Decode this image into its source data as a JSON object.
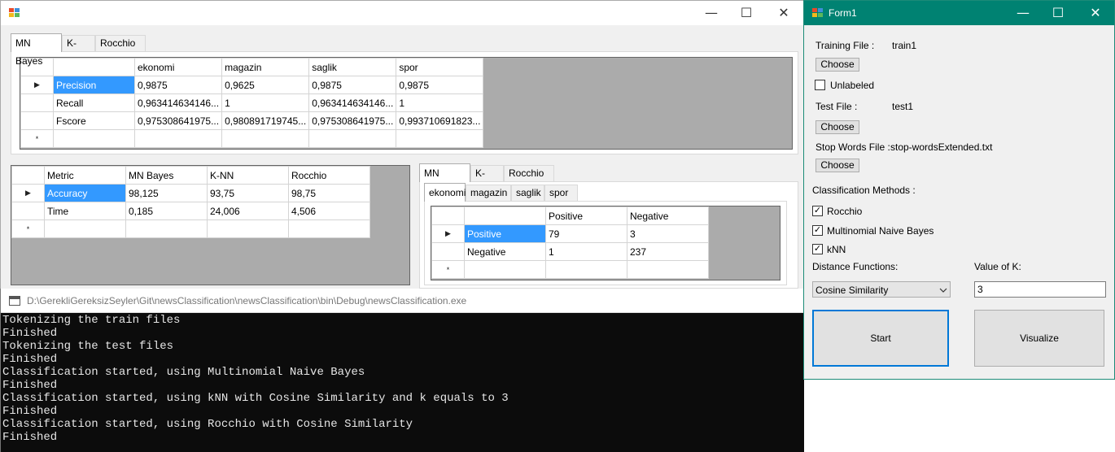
{
  "main_window": {
    "caption_buttons": {
      "minimize": "—",
      "maximize": "☐",
      "close": "✕"
    },
    "top_tabs": [
      "MN Bayes",
      "K-NN",
      "Rocchio"
    ],
    "metrics_grid": {
      "columns": [
        "",
        "ekonomi",
        "magazin",
        "saglik",
        "spor"
      ],
      "rows": [
        [
          "Precision",
          "0,9875",
          "0,9625",
          "0,9875",
          "0,9875"
        ],
        [
          "Recall",
          "0,963414634146...",
          "1",
          "0,963414634146...",
          "1"
        ],
        [
          "Fscore",
          "0,975308641975...",
          "0,980891719745...",
          "0,975308641975...",
          "0,993710691823..."
        ]
      ]
    },
    "accuracy_grid": {
      "columns": [
        "Metric",
        "MN Bayes",
        "K-NN",
        "Rocchio"
      ],
      "rows": [
        [
          "Accuracy",
          "98,125",
          "93,75",
          "98,75"
        ],
        [
          "Time",
          "0,185",
          "24,006",
          "4,506"
        ]
      ]
    },
    "method_tabs": [
      "MN Bayes",
      "K-NN",
      "Rocchio"
    ],
    "category_tabs": [
      "ekonomi",
      "magazin",
      "saglik",
      "spor"
    ],
    "confusion_grid": {
      "columns": [
        "",
        "Positive",
        "Negative"
      ],
      "rows": [
        [
          "Positive",
          "79",
          "3"
        ],
        [
          "Negative",
          "1",
          "237"
        ]
      ]
    },
    "row_markers": {
      "current": "▶",
      "new": "*"
    }
  },
  "console": {
    "title": "D:\\GerekliGereksizSeyler\\Git\\newsClassification\\newsClassification\\bin\\Debug\\newsClassification.exe",
    "lines": [
      "Tokenizing the train files",
      "Finished",
      "Tokenizing the test files",
      "Finished",
      "Classification started, using Multinomial Naive Bayes",
      "Finished",
      "Classification started, using kNN with Cosine Similarity and k equals to 3",
      "Finished",
      "Classification started, using Rocchio with Cosine Similarity",
      "Finished"
    ]
  },
  "form1": {
    "title": "Form1",
    "caption_buttons": {
      "minimize": "—",
      "maximize": "☐",
      "close": "✕"
    },
    "training_file_label": "Training File :",
    "training_file_value": "train1",
    "choose_label": "Choose",
    "unlabeled_label": "Unlabeled",
    "unlabeled_checked": false,
    "test_file_label": "Test File :",
    "test_file_value": "test1",
    "stop_words_label": "Stop Words File :",
    "stop_words_value": "stop-wordsExtended.txt",
    "classification_methods_label": "Classification Methods :",
    "methods": [
      {
        "label": "Rocchio",
        "checked": true
      },
      {
        "label": "Multinomial Naive Bayes",
        "checked": true
      },
      {
        "label": "kNN",
        "checked": true
      }
    ],
    "check_mark": "✓",
    "distance_functions_label": "Distance Functions:",
    "distance_function_selected": "Cosine Similarity",
    "value_of_k_label": "Value of K:",
    "value_of_k": "3",
    "start_label": "Start",
    "visualize_label": "Visualize"
  },
  "colors": {
    "selection": "#3399ff",
    "form1_titlebar": "#008272",
    "console_bg": "#0c0c0c"
  }
}
